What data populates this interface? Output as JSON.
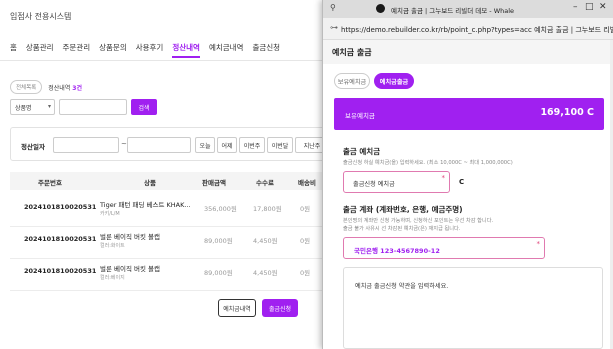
{
  "brand": "입점사 전용시스템",
  "nav": [
    "홈",
    "상품관리",
    "주문관리",
    "상품문의",
    "사용후기",
    "정산내역",
    "예치금내역",
    "출금신청"
  ],
  "filter": {
    "chip": "전체목록",
    "count_label": "정산내역",
    "count_value": "3건"
  },
  "search": {
    "select_value": "상품명",
    "button": "검색"
  },
  "date": {
    "label": "정산일자",
    "sep": "~",
    "quick": [
      "오늘",
      "어제",
      "이번주",
      "이번달",
      "지난주"
    ]
  },
  "table": {
    "headers": [
      "주문번호",
      "상품",
      "판매금액",
      "수수료",
      "배송비"
    ],
    "rows": [
      {
        "no": "2024101810020531",
        "product": "Tiger 패턴 패딩 베스트 KHAK...",
        "option": "카키/L/M",
        "amount": "356,000원",
        "fee": "17,800원",
        "ship": "0원"
      },
      {
        "no": "2024101810020531",
        "product": "벌룬 베이직 버킷 볼캡",
        "option": "컬러:화이트",
        "amount": "89,000원",
        "fee": "4,450원",
        "ship": "0원"
      },
      {
        "no": "2024101810020531",
        "product": "벌룬 베이직 버킷 볼캡",
        "option": "컬러:베이지",
        "amount": "89,000원",
        "fee": "4,450원",
        "ship": "0원"
      }
    ]
  },
  "bottom": {
    "deposit_btn": "예치금내역",
    "withdraw_btn": "출금신청"
  },
  "popup": {
    "title": "예치금 출금 | 그누보드 리빌더 데모 - Whale",
    "url": "https://demo.rebuilder.co.kr/rb/point_c.php?types=acc  예치금 출금 | 그누보드 리빌더",
    "header": "예치금 출금",
    "tabs": [
      "보유예치금",
      "예치금출금"
    ],
    "balance_label": "보유예치금",
    "balance_value": "169,100 C",
    "withdraw_title": "출금 예치금",
    "withdraw_desc": "출금신청 하실 예치금(을) 입력하세요. (최소 10,000C ~ 최대 1,000,000C)",
    "amount_placeholder": "출금신청 예치금",
    "unit": "C",
    "account_title": "출금 계좌 (계좌번호, 은행, 예금주명)",
    "account_desc1": "본인명의 계좌만 신청 가능하며, 신청하신 포인트는 우선 차감 합니다.",
    "account_desc2": "출금 불가 사유시 선 차감된 예치금(은) 재지급 됩니다.",
    "account_value": "국민은행 123-4567890-12",
    "memo_placeholder": "예치금 출금신청 약관을 입력하세요."
  }
}
